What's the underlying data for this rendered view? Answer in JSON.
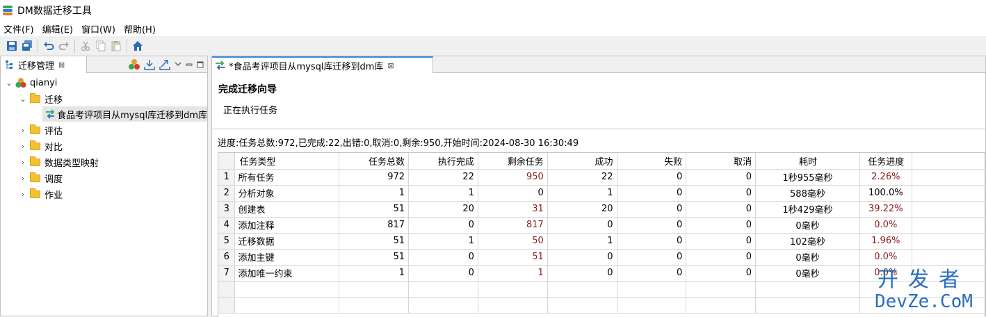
{
  "window": {
    "title": "DM数据迁移工具"
  },
  "menu": [
    "文件(F)",
    "编辑(E)",
    "窗口(W)",
    "帮助(H)"
  ],
  "toolbar_icons": [
    "save-icon",
    "save-all-icon",
    "undo-icon",
    "redo-icon",
    "cut-icon",
    "copy-icon",
    "paste-icon",
    "home-icon"
  ],
  "left_panel": {
    "tab_label": "迁移管理",
    "tab_close": "⊠",
    "tree": {
      "root": "qianyi",
      "migration_folder": "迁移",
      "selected_task": "食品考评项目从mysql库迁移到dm库",
      "folders": [
        "评估",
        "对比",
        "数据类型映射",
        "调度",
        "作业"
      ]
    }
  },
  "editor": {
    "tab_label": "*食品考评项目从mysql库迁移到dm库",
    "tab_close": "⊠",
    "wizard_title": "完成迁移向导",
    "wizard_subtitle": "正在执行任务",
    "progress_text": "进度:任务总数:972,已完成:22,出错:0,取消:0,剩余:950,开始时间:2024-08-30 16:30:49"
  },
  "table": {
    "columns": [
      "任务类型",
      "任务总数",
      "执行完成",
      "剩余任务",
      "成功",
      "失败",
      "取消",
      "耗时",
      "任务进度"
    ],
    "rows": [
      [
        "1",
        "所有任务",
        "972",
        "22",
        "950",
        "22",
        "0",
        "0",
        "1秒955毫秒",
        "2.26%"
      ],
      [
        "2",
        "分析对象",
        "1",
        "1",
        "0",
        "1",
        "0",
        "0",
        "588毫秒",
        "100.0%"
      ],
      [
        "3",
        "创建表",
        "51",
        "20",
        "31",
        "20",
        "0",
        "0",
        "1秒429毫秒",
        "39.22%"
      ],
      [
        "4",
        "添加注释",
        "817",
        "0",
        "817",
        "0",
        "0",
        "0",
        "0毫秒",
        "0.0%"
      ],
      [
        "5",
        "迁移数据",
        "51",
        "1",
        "50",
        "1",
        "0",
        "0",
        "102毫秒",
        "1.96%"
      ],
      [
        "6",
        "添加主键",
        "51",
        "0",
        "51",
        "0",
        "0",
        "0",
        "0毫秒",
        "0.0%"
      ],
      [
        "7",
        "添加唯一约束",
        "1",
        "0",
        "1",
        "0",
        "0",
        "0",
        "0毫秒",
        "0.0%"
      ]
    ]
  },
  "watermark": {
    "top": "开发者",
    "bottom": "DevZe.CoM"
  },
  "colors": {
    "accent_blue": "#3c8ad5",
    "red_value": "#8b1a1a",
    "folder_yellow": "#f5c132"
  }
}
